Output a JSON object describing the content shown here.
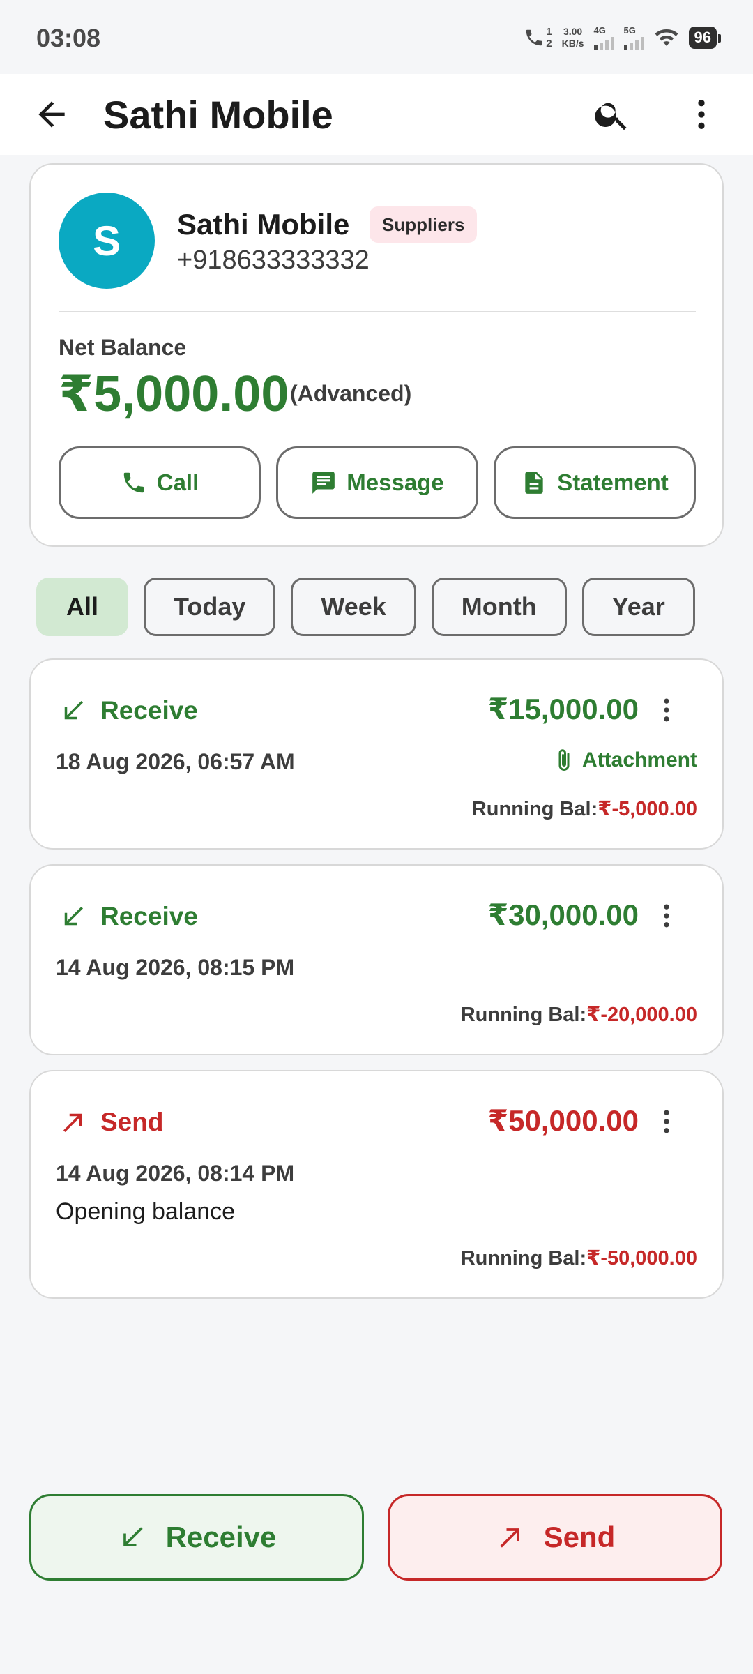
{
  "status_bar": {
    "time": "03:08",
    "sim_slot_top": "1",
    "sim_slot_bottom": "2",
    "speed_value": "3.00",
    "speed_unit": "KB/s",
    "net1": "4G",
    "net2": "5G",
    "battery": "96"
  },
  "app_bar": {
    "title": "Sathi Mobile",
    "icons": [
      "arrow-back-icon",
      "search-icon",
      "more-vert-icon"
    ]
  },
  "contact": {
    "avatar_letter": "S",
    "avatar_color": "#0aa9c2",
    "name": "Sathi Mobile",
    "badge": "Suppliers",
    "phone": "+918633333332",
    "net_balance_label": "Net Balance",
    "net_balance_amount": "₹5,000.00",
    "net_balance_note": "(Advanced)",
    "actions": {
      "call": "Call",
      "message": "Message",
      "statement": "Statement"
    }
  },
  "filters": [
    "All",
    "Today",
    "Week",
    "Month",
    "Year"
  ],
  "active_filter": "All",
  "transactions": [
    {
      "type": "Receive",
      "amount": "₹15,000.00",
      "date": "18 Aug 2026, 06:57 AM",
      "attachment": "Attachment",
      "running_label": "Running Bal:",
      "running_value": "₹-5,000.00"
    },
    {
      "type": "Receive",
      "amount": "₹30,000.00",
      "date": "14 Aug 2026, 08:15 PM",
      "running_label": "Running Bal:",
      "running_value": "₹-20,000.00"
    },
    {
      "type": "Send",
      "amount": "₹50,000.00",
      "date": "14 Aug 2026, 08:14 PM",
      "note": "Opening balance",
      "running_label": "Running Bal:",
      "running_value": "₹-50,000.00"
    }
  ],
  "bottom_actions": {
    "receive": "Receive",
    "send": "Send"
  },
  "colors": {
    "receive": "#2e7d32",
    "send": "#c62828",
    "active_chip": "#d2e9d2"
  }
}
